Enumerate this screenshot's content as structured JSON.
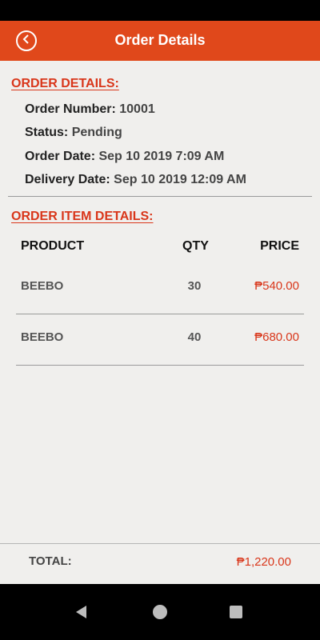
{
  "app": {
    "title": "Order Details",
    "accent_color": "#e0481b",
    "price_color": "#d9361a"
  },
  "order_details": {
    "heading": "ORDER DETAILS:",
    "rows": [
      {
        "label": "Order Number:",
        "value": "10001"
      },
      {
        "label": "Status:",
        "value": "Pending"
      },
      {
        "label": "Order Date:",
        "value": "Sep 10 2019 7:09 AM"
      },
      {
        "label": "Delivery Date:",
        "value": "Sep 10 2019 12:09 AM"
      }
    ]
  },
  "order_items": {
    "heading": "ORDER ITEM DETAILS:",
    "columns": {
      "product": "PRODUCT",
      "qty": "QTY",
      "price": "PRICE"
    },
    "items": [
      {
        "product": "BEEBO",
        "qty": "30",
        "price": "₱540.00"
      },
      {
        "product": "BEEBO",
        "qty": "40",
        "price": "₱680.00"
      }
    ]
  },
  "total": {
    "label": "TOTAL:",
    "value": "₱1,220.00"
  },
  "icons": {
    "back": "back-circle-icon",
    "nav_back": "nav-back-icon",
    "nav_home": "nav-home-icon",
    "nav_recent": "nav-recent-icon"
  }
}
